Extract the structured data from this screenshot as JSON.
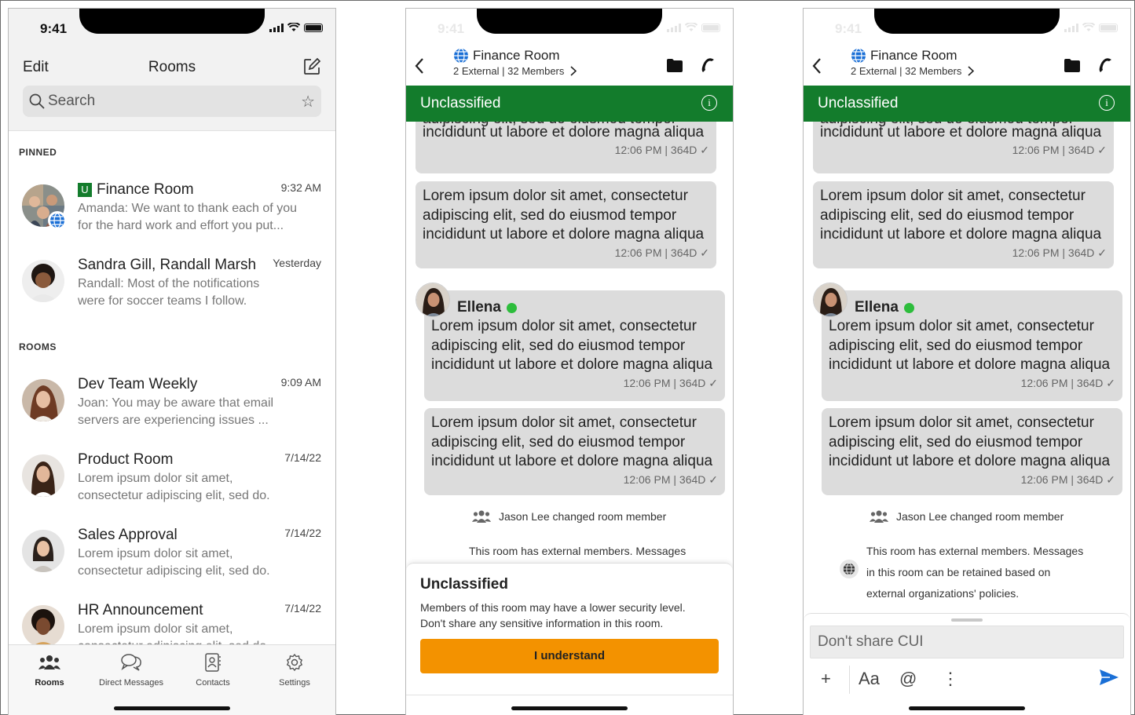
{
  "status": {
    "time": "9:41"
  },
  "rooms_screen": {
    "edit": "Edit",
    "title": "Rooms",
    "search_placeholder": "Search",
    "pinned_label": "PINNED",
    "rooms_label": "ROOMS",
    "pinned": [
      {
        "badge": "U",
        "name": "Finance Room",
        "time": "9:32 AM",
        "preview1": "Amanda: We want to thank each of you",
        "preview2": "for the hard work and effort you put..."
      },
      {
        "name": "Sandra Gill, Randall Marsh",
        "time": "Yesterday",
        "preview1": "Randall: Most of the notifications",
        "preview2": "were for soccer teams I follow."
      }
    ],
    "rooms": [
      {
        "name": "Dev Team Weekly",
        "time": "9:09 AM",
        "preview1": "Joan: You may be aware that email",
        "preview2": "servers are experiencing issues ..."
      },
      {
        "name": "Product Room",
        "time": "7/14/22",
        "preview1": "Lorem ipsum dolor sit amet,",
        "preview2": "consectetur adipiscing elit, sed do."
      },
      {
        "name": "Sales Approval",
        "time": "7/14/22",
        "preview1": "Lorem ipsum dolor sit amet,",
        "preview2": "consectetur adipiscing elit, sed do."
      },
      {
        "name": "HR Announcement",
        "time": "7/14/22",
        "preview1": "Lorem ipsum dolor sit amet,",
        "preview2": "consectetur adipiscing elit, sed do."
      }
    ],
    "tabs": {
      "rooms": "Rooms",
      "dm": "Direct Messages",
      "contacts": "Contacts",
      "settings": "Settings"
    }
  },
  "chat": {
    "room_name": "Finance Room",
    "subtitle": "2 External | 32 Members",
    "classification": "Unclassified",
    "cut_line": "adipiscing elit, sed do eiusmod tempor",
    "line1": "Lorem ipsum dolor sit amet, consectetur",
    "line2": "adipiscing elit, sed do eiusmod tempor",
    "line3": "incididunt ut labore et dolore magna aliqua",
    "meta": "12:06 PM | 364D ✓",
    "sender": "Ellena",
    "system_msg": "Jason Lee changed room member",
    "ext1": "This room has external members. Messages",
    "ext2": "in this room can be retained based on",
    "ext3": "external organizations' policies.",
    "sheet_title": "Unclassified",
    "sheet_msg1": "Members of this room may have a lower security level.",
    "sheet_msg2": "Don't share any sensitive information in this room.",
    "sheet_button": "I understand",
    "composer_placeholder": "Don't share CUI",
    "format_label": "Aa",
    "mention_label": "@"
  }
}
